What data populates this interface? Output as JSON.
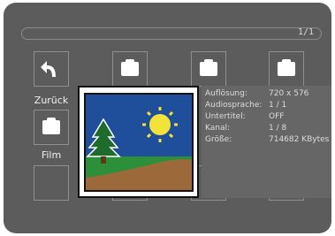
{
  "page_indicator": "1/1",
  "tiles": [
    {
      "name": "zurueck",
      "label": "Zurück",
      "icon": "back-arrow-icon"
    },
    {
      "name": "folder-1",
      "label": "",
      "icon": "folder-icon"
    },
    {
      "name": "folder-2",
      "label": "",
      "icon": "folder-icon"
    },
    {
      "name": "folder-3",
      "label": "",
      "icon": "folder-icon"
    },
    {
      "name": "film",
      "label": "Film",
      "icon": "folder-icon"
    }
  ],
  "info": {
    "aufloesung": {
      "key": "Auflösung:",
      "value": "720 x 576"
    },
    "audiosprache": {
      "key": "Audiosprache:",
      "value": "1 / 1"
    },
    "untertitel": {
      "key": "Untertitel:",
      "value": "OFF"
    },
    "kanal": {
      "key": "Kanal:",
      "value": "1 / 8"
    },
    "groesse": {
      "key": "Größe:",
      "value": "714682 KBytes"
    }
  },
  "preview_icon": "image-placeholder-icon",
  "colors": {
    "background": "#5c5c5c",
    "sky": "#1f4e9a",
    "grass": "#2e8f3a",
    "hill": "#9c6a3a",
    "sun": "#f2e23a",
    "tree": "#1f6b2c"
  }
}
